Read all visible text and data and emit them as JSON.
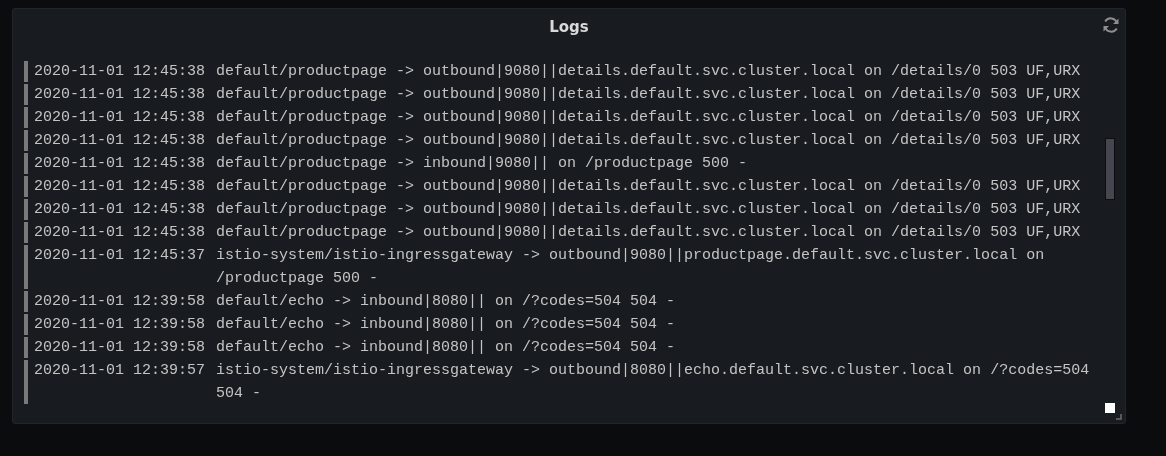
{
  "panel": {
    "title": "Logs"
  },
  "logs": [
    {
      "time": "2020-11-01 12:45:38",
      "message": "default/productpage -> outbound|9080||details.default.svc.cluster.local on /details/0 503 UF,URX"
    },
    {
      "time": "2020-11-01 12:45:38",
      "message": "default/productpage -> outbound|9080||details.default.svc.cluster.local on /details/0 503 UF,URX"
    },
    {
      "time": "2020-11-01 12:45:38",
      "message": "default/productpage -> outbound|9080||details.default.svc.cluster.local on /details/0 503 UF,URX"
    },
    {
      "time": "2020-11-01 12:45:38",
      "message": "default/productpage -> outbound|9080||details.default.svc.cluster.local on /details/0 503 UF,URX"
    },
    {
      "time": "2020-11-01 12:45:38",
      "message": "default/productpage -> inbound|9080|| on /productpage 500 -"
    },
    {
      "time": "2020-11-01 12:45:38",
      "message": "default/productpage -> outbound|9080||details.default.svc.cluster.local on /details/0 503 UF,URX"
    },
    {
      "time": "2020-11-01 12:45:38",
      "message": "default/productpage -> outbound|9080||details.default.svc.cluster.local on /details/0 503 UF,URX"
    },
    {
      "time": "2020-11-01 12:45:38",
      "message": "default/productpage -> outbound|9080||details.default.svc.cluster.local on /details/0 503 UF,URX"
    },
    {
      "time": "2020-11-01 12:45:37",
      "message": "istio-system/istio-ingressgateway -> outbound|9080||productpage.default.svc.cluster.local on /productpage 500 -"
    },
    {
      "time": "2020-11-01 12:39:58",
      "message": "default/echo -> inbound|8080|| on /?codes=504 504 -"
    },
    {
      "time": "2020-11-01 12:39:58",
      "message": "default/echo -> inbound|8080|| on /?codes=504 504 -"
    },
    {
      "time": "2020-11-01 12:39:58",
      "message": "default/echo -> inbound|8080|| on /?codes=504 504 -"
    },
    {
      "time": "2020-11-01 12:39:57",
      "message": "istio-system/istio-ingressgateway -> outbound|8080||echo.default.svc.cluster.local on /?codes=504 504 -"
    }
  ]
}
